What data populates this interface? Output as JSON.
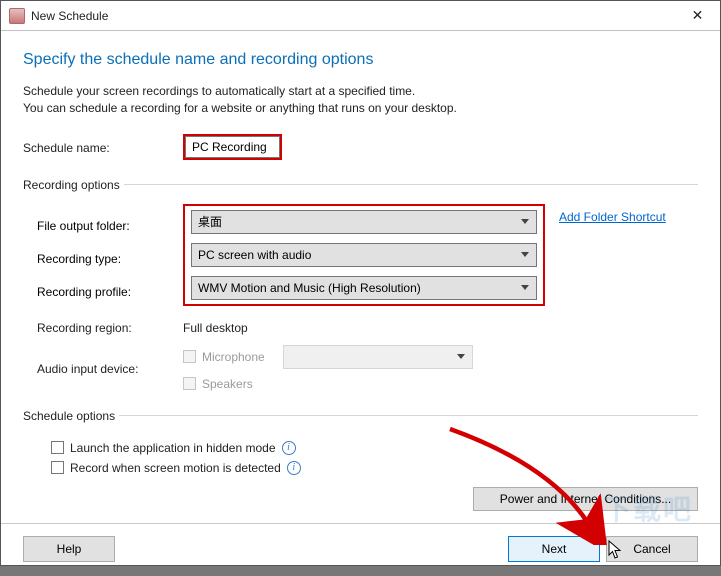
{
  "window": {
    "title": "New Schedule"
  },
  "heading": "Specify the schedule name and recording options",
  "description_line1": "Schedule your screen recordings to automatically start at a specified time.",
  "description_line2": "You can schedule a recording for a website or anything that runs on your desktop.",
  "schedule_name": {
    "label": "Schedule name:",
    "value": "PC Recording"
  },
  "recording_options": {
    "legend": "Recording options",
    "file_output_folder": {
      "label": "File output folder:",
      "value": "桌面"
    },
    "recording_type": {
      "label": "Recording type:",
      "value": "PC screen with audio"
    },
    "recording_profile": {
      "label": "Recording profile:",
      "value": "WMV Motion and Music (High Resolution)"
    },
    "add_folder_shortcut": "Add Folder Shortcut",
    "recording_region": {
      "label": "Recording region:",
      "value": "Full desktop"
    },
    "audio_input_device": {
      "label": "Audio input device:",
      "microphone": "Microphone",
      "speakers": "Speakers",
      "select_value": ""
    }
  },
  "schedule_options": {
    "legend": "Schedule options",
    "hidden_mode": "Launch the application in hidden mode",
    "motion_detected": "Record when screen motion is detected",
    "power_conditions": "Power and Internet Conditions..."
  },
  "buttons": {
    "help": "Help",
    "next": "Next",
    "cancel": "Cancel"
  },
  "watermark": "下载吧"
}
